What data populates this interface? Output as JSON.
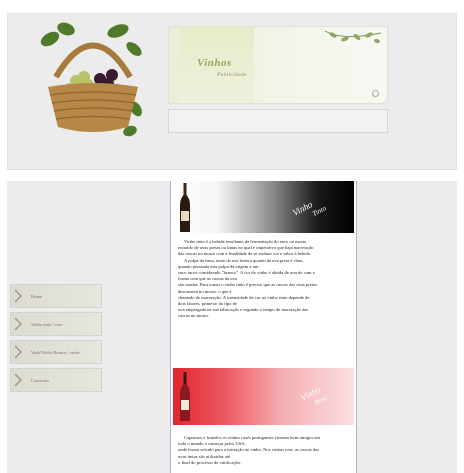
{
  "header": {
    "brand_title": "Vinhos",
    "brand_subtitle": "Publicidade"
  },
  "sidebar": {
    "items": [
      {
        "label": "Home",
        "icon": "arrow-icon"
      },
      {
        "label": "Vinho tinto / rose",
        "icon": "arrow-icon"
      },
      {
        "label": "Vinh/Vinho Branco / verde",
        "icon": "arrow-icon"
      },
      {
        "label": "Contactos",
        "icon": "arrow-icon"
      }
    ]
  },
  "content": {
    "tinto_banner": {
      "line1": "Vinho",
      "line2": "Tinto"
    },
    "rose_banner": {
      "line1": "Vinho",
      "line2": "Rosé"
    },
    "tinto_text": [
      "Vinho tinto é a bebida resultante da fermentação do suco ou mosto",
      "extraído de uvas pretas ou tintas no qual é imperativo que haja maceração",
      "das cascas no mosto com a finalidade de se atribuir cor e sabor à bebida.",
      "A polpa da fruta, tanto da uva branca quanto da uva preta é clara,",
      "quando prensada esta polpa dá origem a um",
      "suco turvo considerado \"branco\". A cor do vinho é obtida de acordo com a",
      "forma com que as cascas da uva",
      "são usadas. Para tornar o vinho tinto é preciso que as cascas das uvas pretas",
      "descansem no mosto, o que é",
      "chamado de maceração. A intensidade da cor no vinho tinto depende de",
      "dois fatores, primeiro do tipo de",
      "uva empregada na sua fabricação e segundo o tempo de maceração das",
      "cascas no mosto."
    ],
    "rose_text": [
      "Capitosos e frutados os vinhos rosés portugueses fizeram bons amigos em",
      "todo o mundo a começar pelos USA,",
      "onde foram veículo para a iniciação ao vinho. Nos vinhos rose, as cascas das",
      "uvas tintas são utilizadas até",
      "o final do processo de vinificação."
    ]
  },
  "colors": {
    "panel_bg": "#ececec",
    "content_border": "#c9a6d8",
    "brand_green": "#9aa55a",
    "rose_red": "#e0262e"
  }
}
